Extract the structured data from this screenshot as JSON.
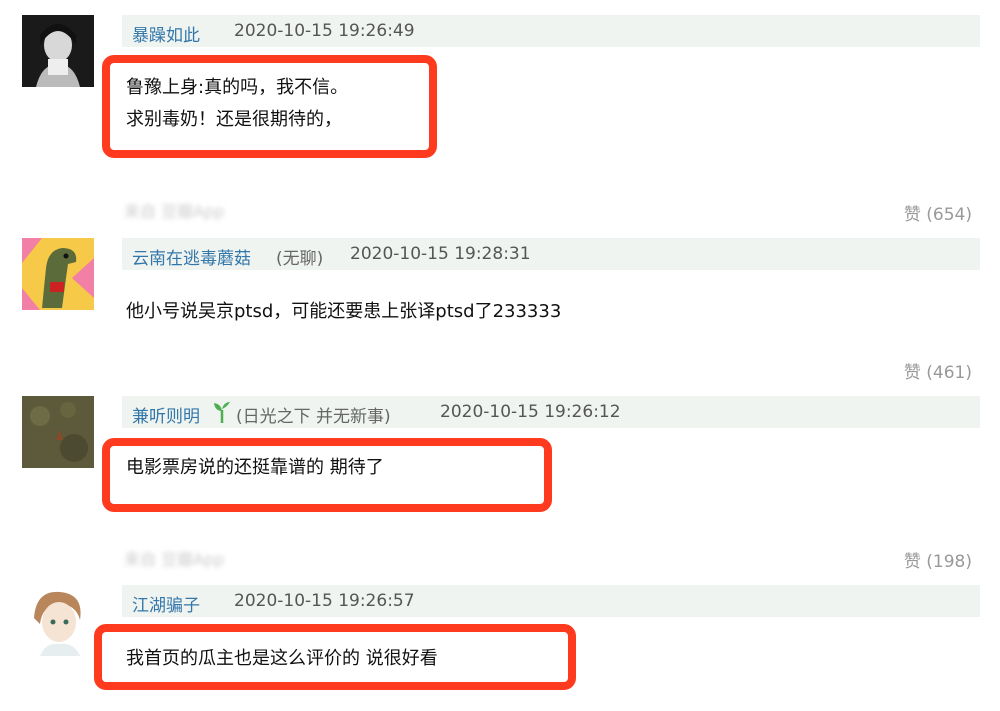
{
  "comments": [
    {
      "username": "暴躁如此",
      "extra": "",
      "time": "2020-10-15 19:26:49",
      "lines": [
        "鲁豫上身:真的吗，我不信。",
        "求别毒奶！还是很期待的，"
      ],
      "source": "来自 豆瓣App",
      "likes": "赞 (654)"
    },
    {
      "username": "云南在逃毒蘑菇",
      "extra": "(无聊)",
      "time": "2020-10-15 19:28:31",
      "lines": [
        "他小号说吴京ptsd，可能还要患上张译ptsd了233333"
      ],
      "source": "",
      "likes": "赞 (461)"
    },
    {
      "username": "兼听则明",
      "extra": "(日光之下 并无新事)",
      "time": "2020-10-15 19:26:12",
      "lines": [
        "电影票房说的还挺靠谱的 期待了"
      ],
      "source": "来自 豆瓣App",
      "likes": "赞 (198)"
    },
    {
      "username": "江湖骗子",
      "extra": "",
      "time": "2020-10-15 19:26:57",
      "lines": [
        "我首页的瓜主也是这么评价的 说很好看"
      ],
      "source": "",
      "likes": ""
    }
  ],
  "colors": {
    "username": "#3377aa",
    "header_bg": "#f0f4f1",
    "highlight": "#ff3b1f",
    "muted": "#999999"
  }
}
